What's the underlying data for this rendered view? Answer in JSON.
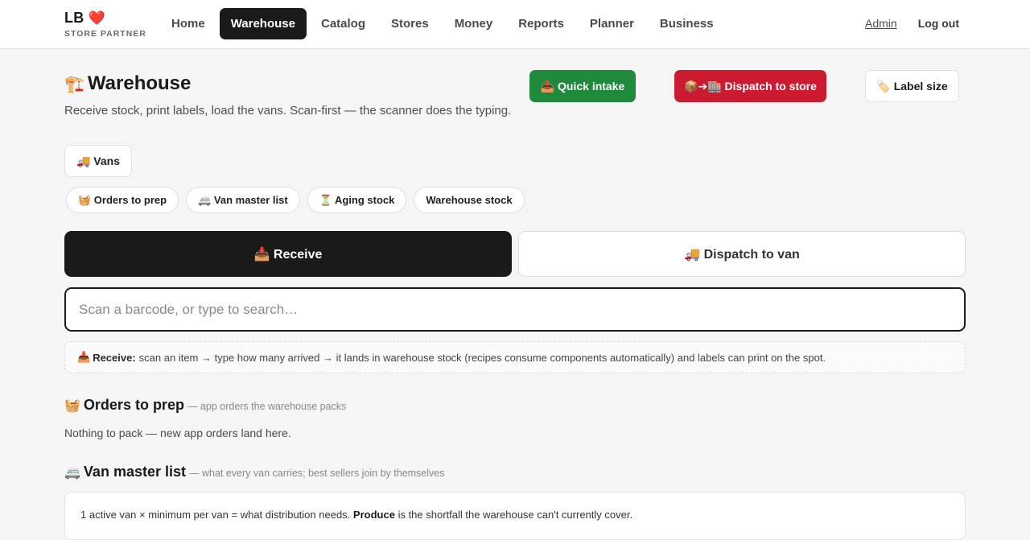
{
  "brand": {
    "name": "LB",
    "heart": "❤️",
    "sub": "STORE PARTNER"
  },
  "nav": {
    "items": [
      {
        "label": "Home"
      },
      {
        "label": "Warehouse"
      },
      {
        "label": "Catalog"
      },
      {
        "label": "Stores"
      },
      {
        "label": "Money"
      },
      {
        "label": "Reports"
      },
      {
        "label": "Planner"
      },
      {
        "label": "Business"
      }
    ],
    "active_index": 1,
    "admin": "Admin",
    "logout": "Log out"
  },
  "header": {
    "emoji": "🏗️",
    "title": "Warehouse",
    "subtitle": "Receive stock, print labels, load the vans. Scan-first — the scanner does the typing."
  },
  "actions": {
    "quick_intake": "📥 Quick intake",
    "dispatch_store": "📦➔🏬 Dispatch to store",
    "label_size": "🏷️ Label size"
  },
  "vans_button": "🚚 Vans",
  "chips": [
    {
      "label": "🧺 Orders to prep"
    },
    {
      "label": "🚐 Van master list"
    },
    {
      "label": "⏳ Aging stock"
    },
    {
      "label": "Warehouse stock"
    }
  ],
  "modes": {
    "receive": "📥 Receive",
    "dispatch": "🚚 Dispatch to van"
  },
  "search": {
    "placeholder": "Scan a barcode, or type to search…",
    "value": ""
  },
  "hint": {
    "icon": "📥",
    "label": "Receive:",
    "text": "scan an item → type how many arrived → it lands in warehouse stock (recipes consume components automatically) and labels can print on the spot."
  },
  "orders_section": {
    "emoji": "🧺",
    "title": "Orders to prep",
    "note": "— app orders the warehouse packs",
    "empty": "Nothing to pack — new app orders land here."
  },
  "van_section": {
    "emoji": "🚐",
    "title": "Van master list",
    "note": "— what every van carries; best sellers join by themselves",
    "info_pre": "1 active van × minimum per van = what distribution needs.",
    "info_bold": "Produce",
    "info_post": "is the shortfall the warehouse can't currently cover."
  }
}
